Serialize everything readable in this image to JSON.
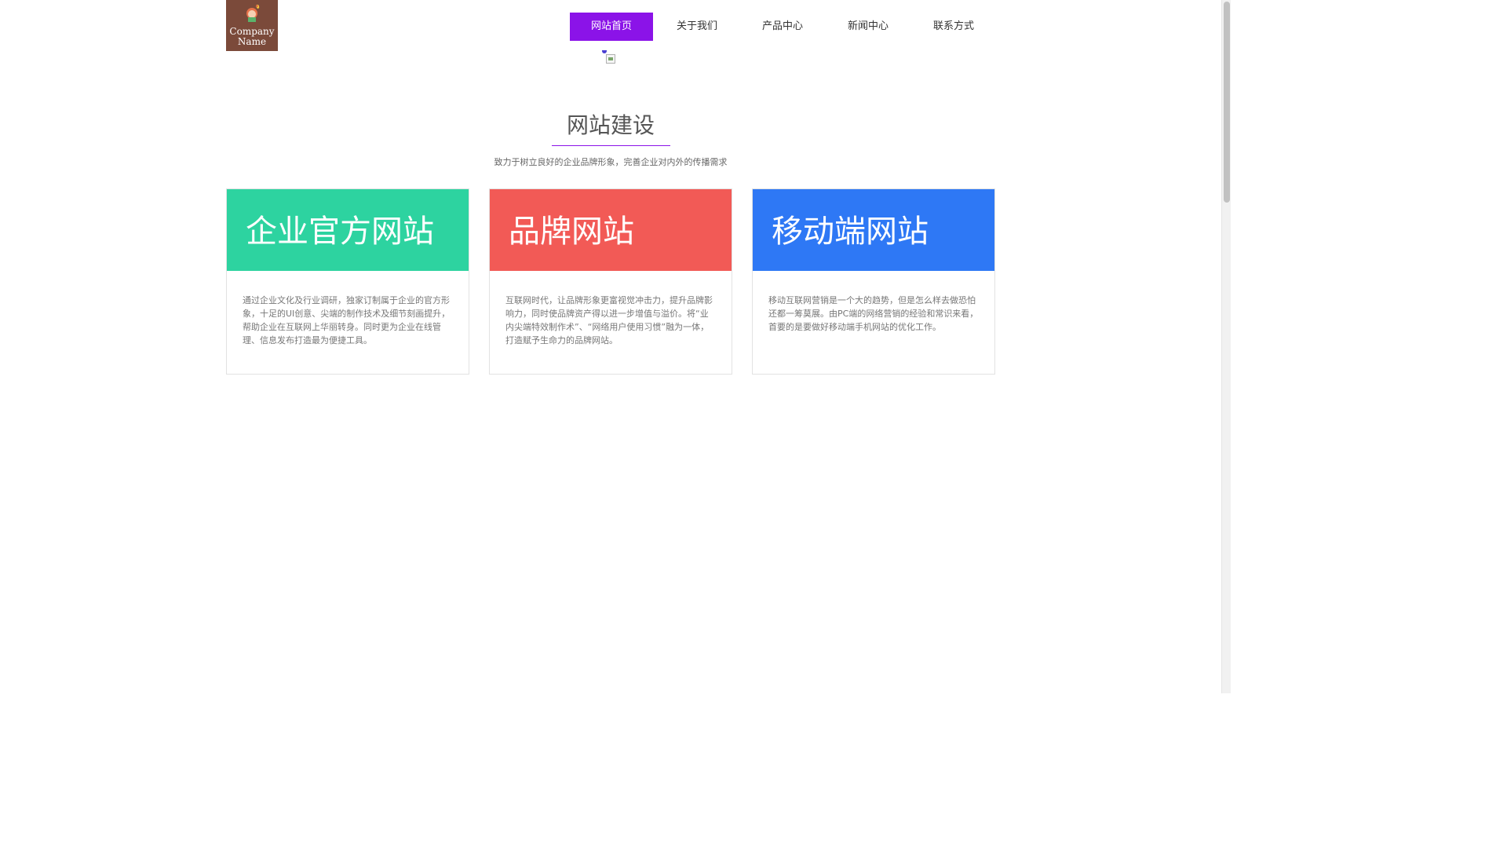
{
  "header": {
    "logo": {
      "line1": "Company",
      "line2": "Name",
      "icon": "girl-heart-icon",
      "bg_color": "#7b4a3a"
    },
    "nav": [
      {
        "label": "网站首页",
        "active": true
      },
      {
        "label": "关于我们",
        "active": false
      },
      {
        "label": "产品中心",
        "active": false
      },
      {
        "label": "新闻中心",
        "active": false
      },
      {
        "label": "联系方式",
        "active": false
      }
    ],
    "accent_color": "#8b13e8"
  },
  "section": {
    "title": "网站建设",
    "subtitle": "致力于树立良好的企业品牌形象，完善企业对内外的传播需求"
  },
  "cards": [
    {
      "title": "企业官方网站",
      "color": "#2dd3a0",
      "desc": "通过企业文化及行业调研，独家订制属于企业的官方形象，十足的UI创意、尖端的制作技术及细节刻画提升，帮助企业在互联网上华丽转身。同时更为企业在线管理、信息发布打造最为便捷工具。"
    },
    {
      "title": "品牌网站",
      "color": "#f25a56",
      "desc": "互联网时代，让品牌形象更富视觉冲击力，提升品牌影响力，同时使品牌资产得以进一步增值与溢价。将“业内尖端特效制作术”、“网络用户使用习惯”融为一体，打造赋予生命力的品牌网站。"
    },
    {
      "title": "移动端网站",
      "color": "#2e78f5",
      "desc": "移动互联网营销是一个大的趋势，但是怎么样去做恐怕还都一筹莫展。由PC端的网络营销的经验和常识来看，首要的是要做好移动端手机网站的优化工作。"
    }
  ]
}
